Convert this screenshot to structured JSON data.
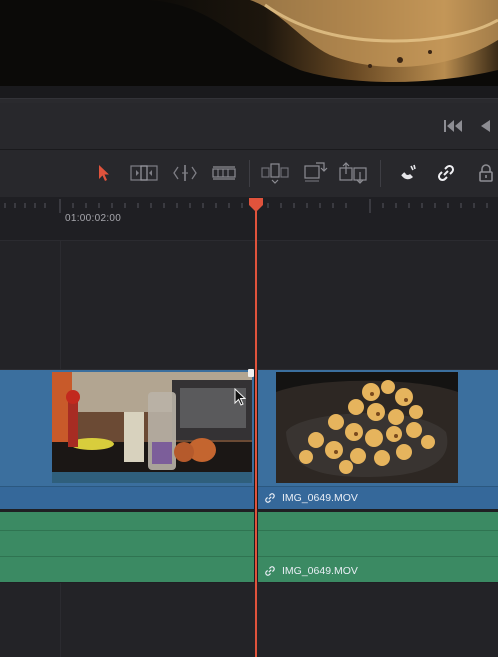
{
  "viewer": {
    "description_icon": "video-frame"
  },
  "transport": {
    "buttons": [
      {
        "name": "jump-to-start-icon"
      },
      {
        "name": "play-reverse-icon"
      }
    ]
  },
  "toolbar": {
    "tools": [
      {
        "name": "selection-mode-icon",
        "color": "#e0533c"
      },
      {
        "name": "trim-edit-mode-icon"
      },
      {
        "name": "dynamic-trim-mode-icon"
      },
      {
        "name": "blade-edit-mode-icon"
      },
      {
        "name": "insert-clip-icon"
      },
      {
        "name": "overwrite-clip-icon"
      },
      {
        "name": "replace-clip-icon"
      },
      {
        "name": "snapping-icon"
      },
      {
        "name": "linked-selection-icon"
      },
      {
        "name": "position-lock-icon"
      }
    ]
  },
  "ruler": {
    "timecode": "01:00:02:00"
  },
  "clips": {
    "video_b_label": "IMG_0649.MOV",
    "audio_b_label": "IMG_0649.MOV"
  },
  "colors": {
    "playhead": "#e0533c",
    "video_clip": "#3b6f9e",
    "audio_clip": "#3b8a63"
  }
}
